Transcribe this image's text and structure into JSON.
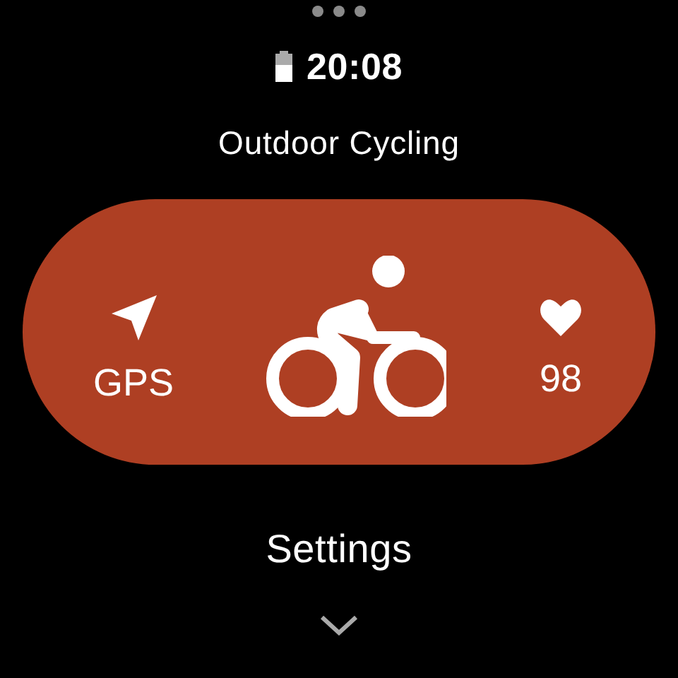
{
  "status_bar": {
    "time": "20:08"
  },
  "title": "Outdoor Cycling",
  "activity_card": {
    "left": {
      "label": "GPS"
    },
    "right": {
      "label": "98"
    }
  },
  "settings": {
    "label": "Settings"
  }
}
